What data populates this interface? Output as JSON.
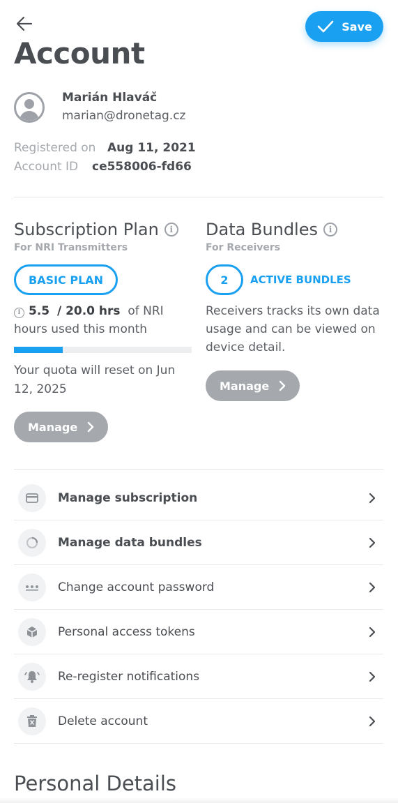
{
  "header": {
    "title": "Account",
    "save_label": "Save"
  },
  "user": {
    "name": "Marián Hlaváč",
    "email": "marian@dronetag.cz"
  },
  "meta": {
    "registered_label": "Registered on",
    "registered_value": "Aug 11, 2021",
    "account_id_label": "Account ID",
    "account_id_value": "ce558006-fd66"
  },
  "subscription": {
    "title": "Subscription Plan",
    "subtitle": "For NRI Transmitters",
    "plan_label": "BASIC PLAN",
    "used": "5.5",
    "total": "/ 20.0 hrs",
    "usage_suffix": "of NRI hours used this month",
    "progress_fraction": 0.275,
    "reset_text": "Your quota will reset on Jun 12, 2025",
    "manage_label": "Manage"
  },
  "bundles": {
    "title": "Data Bundles",
    "subtitle": "For Receivers",
    "count": "2",
    "active_label": "ACTIVE BUNDLES",
    "description": "Receivers tracks its own data usage and can be viewed on device detail.",
    "manage_label": "Manage"
  },
  "menu": [
    {
      "label": "Manage subscription",
      "icon": "credit-card-icon"
    },
    {
      "label": "Manage data bundles",
      "icon": "pie-chart-icon"
    },
    {
      "label": "Change account password",
      "icon": "password-dots-icon"
    },
    {
      "label": "Personal access tokens",
      "icon": "cube-icon"
    },
    {
      "label": "Re-register notifications",
      "icon": "bell-ring-icon"
    },
    {
      "label": "Delete account",
      "icon": "trash-icon"
    }
  ],
  "personal_details_title": "Personal Details",
  "colors": {
    "accent": "#1aa0f0",
    "muted_button": "#a5a9ae",
    "text": "#4a4d52"
  }
}
